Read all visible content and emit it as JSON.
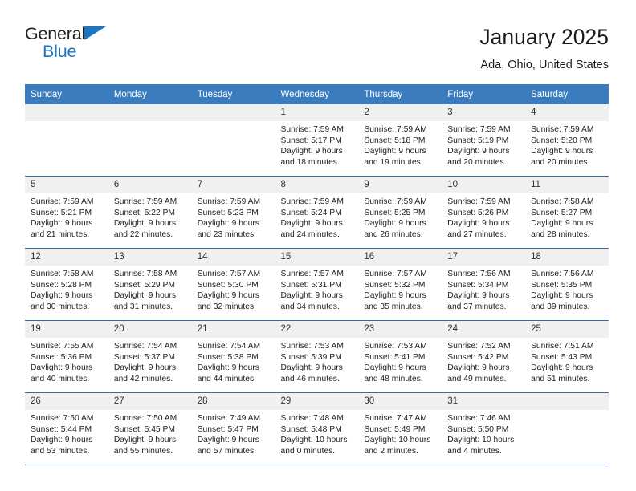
{
  "brand": {
    "name_top": "General",
    "name_bottom": "Blue",
    "triangle_color": "#1a76c4"
  },
  "header": {
    "title": "January 2025",
    "subtitle": "Ada, Ohio, United States"
  },
  "theme": {
    "header_bg": "#3a7cbe",
    "header_text": "#ffffff",
    "daynum_bg": "#f0f0f0",
    "grid_line": "#2f6ca8"
  },
  "calendar": {
    "weekday_headers": [
      "Sunday",
      "Monday",
      "Tuesday",
      "Wednesday",
      "Thursday",
      "Friday",
      "Saturday"
    ],
    "weeks": [
      [
        {
          "day": "",
          "empty": true,
          "sunrise": "",
          "sunset": "",
          "daylight_l1": "",
          "daylight_l2": ""
        },
        {
          "day": "",
          "empty": true,
          "sunrise": "",
          "sunset": "",
          "daylight_l1": "",
          "daylight_l2": ""
        },
        {
          "day": "",
          "empty": true,
          "sunrise": "",
          "sunset": "",
          "daylight_l1": "",
          "daylight_l2": ""
        },
        {
          "day": "1",
          "sunrise": "Sunrise: 7:59 AM",
          "sunset": "Sunset: 5:17 PM",
          "daylight_l1": "Daylight: 9 hours",
          "daylight_l2": "and 18 minutes."
        },
        {
          "day": "2",
          "sunrise": "Sunrise: 7:59 AM",
          "sunset": "Sunset: 5:18 PM",
          "daylight_l1": "Daylight: 9 hours",
          "daylight_l2": "and 19 minutes."
        },
        {
          "day": "3",
          "sunrise": "Sunrise: 7:59 AM",
          "sunset": "Sunset: 5:19 PM",
          "daylight_l1": "Daylight: 9 hours",
          "daylight_l2": "and 20 minutes."
        },
        {
          "day": "4",
          "sunrise": "Sunrise: 7:59 AM",
          "sunset": "Sunset: 5:20 PM",
          "daylight_l1": "Daylight: 9 hours",
          "daylight_l2": "and 20 minutes."
        }
      ],
      [
        {
          "day": "5",
          "sunrise": "Sunrise: 7:59 AM",
          "sunset": "Sunset: 5:21 PM",
          "daylight_l1": "Daylight: 9 hours",
          "daylight_l2": "and 21 minutes."
        },
        {
          "day": "6",
          "sunrise": "Sunrise: 7:59 AM",
          "sunset": "Sunset: 5:22 PM",
          "daylight_l1": "Daylight: 9 hours",
          "daylight_l2": "and 22 minutes."
        },
        {
          "day": "7",
          "sunrise": "Sunrise: 7:59 AM",
          "sunset": "Sunset: 5:23 PM",
          "daylight_l1": "Daylight: 9 hours",
          "daylight_l2": "and 23 minutes."
        },
        {
          "day": "8",
          "sunrise": "Sunrise: 7:59 AM",
          "sunset": "Sunset: 5:24 PM",
          "daylight_l1": "Daylight: 9 hours",
          "daylight_l2": "and 24 minutes."
        },
        {
          "day": "9",
          "sunrise": "Sunrise: 7:59 AM",
          "sunset": "Sunset: 5:25 PM",
          "daylight_l1": "Daylight: 9 hours",
          "daylight_l2": "and 26 minutes."
        },
        {
          "day": "10",
          "sunrise": "Sunrise: 7:59 AM",
          "sunset": "Sunset: 5:26 PM",
          "daylight_l1": "Daylight: 9 hours",
          "daylight_l2": "and 27 minutes."
        },
        {
          "day": "11",
          "sunrise": "Sunrise: 7:58 AM",
          "sunset": "Sunset: 5:27 PM",
          "daylight_l1": "Daylight: 9 hours",
          "daylight_l2": "and 28 minutes."
        }
      ],
      [
        {
          "day": "12",
          "sunrise": "Sunrise: 7:58 AM",
          "sunset": "Sunset: 5:28 PM",
          "daylight_l1": "Daylight: 9 hours",
          "daylight_l2": "and 30 minutes."
        },
        {
          "day": "13",
          "sunrise": "Sunrise: 7:58 AM",
          "sunset": "Sunset: 5:29 PM",
          "daylight_l1": "Daylight: 9 hours",
          "daylight_l2": "and 31 minutes."
        },
        {
          "day": "14",
          "sunrise": "Sunrise: 7:57 AM",
          "sunset": "Sunset: 5:30 PM",
          "daylight_l1": "Daylight: 9 hours",
          "daylight_l2": "and 32 minutes."
        },
        {
          "day": "15",
          "sunrise": "Sunrise: 7:57 AM",
          "sunset": "Sunset: 5:31 PM",
          "daylight_l1": "Daylight: 9 hours",
          "daylight_l2": "and 34 minutes."
        },
        {
          "day": "16",
          "sunrise": "Sunrise: 7:57 AM",
          "sunset": "Sunset: 5:32 PM",
          "daylight_l1": "Daylight: 9 hours",
          "daylight_l2": "and 35 minutes."
        },
        {
          "day": "17",
          "sunrise": "Sunrise: 7:56 AM",
          "sunset": "Sunset: 5:34 PM",
          "daylight_l1": "Daylight: 9 hours",
          "daylight_l2": "and 37 minutes."
        },
        {
          "day": "18",
          "sunrise": "Sunrise: 7:56 AM",
          "sunset": "Sunset: 5:35 PM",
          "daylight_l1": "Daylight: 9 hours",
          "daylight_l2": "and 39 minutes."
        }
      ],
      [
        {
          "day": "19",
          "sunrise": "Sunrise: 7:55 AM",
          "sunset": "Sunset: 5:36 PM",
          "daylight_l1": "Daylight: 9 hours",
          "daylight_l2": "and 40 minutes."
        },
        {
          "day": "20",
          "sunrise": "Sunrise: 7:54 AM",
          "sunset": "Sunset: 5:37 PM",
          "daylight_l1": "Daylight: 9 hours",
          "daylight_l2": "and 42 minutes."
        },
        {
          "day": "21",
          "sunrise": "Sunrise: 7:54 AM",
          "sunset": "Sunset: 5:38 PM",
          "daylight_l1": "Daylight: 9 hours",
          "daylight_l2": "and 44 minutes."
        },
        {
          "day": "22",
          "sunrise": "Sunrise: 7:53 AM",
          "sunset": "Sunset: 5:39 PM",
          "daylight_l1": "Daylight: 9 hours",
          "daylight_l2": "and 46 minutes."
        },
        {
          "day": "23",
          "sunrise": "Sunrise: 7:53 AM",
          "sunset": "Sunset: 5:41 PM",
          "daylight_l1": "Daylight: 9 hours",
          "daylight_l2": "and 48 minutes."
        },
        {
          "day": "24",
          "sunrise": "Sunrise: 7:52 AM",
          "sunset": "Sunset: 5:42 PM",
          "daylight_l1": "Daylight: 9 hours",
          "daylight_l2": "and 49 minutes."
        },
        {
          "day": "25",
          "sunrise": "Sunrise: 7:51 AM",
          "sunset": "Sunset: 5:43 PM",
          "daylight_l1": "Daylight: 9 hours",
          "daylight_l2": "and 51 minutes."
        }
      ],
      [
        {
          "day": "26",
          "sunrise": "Sunrise: 7:50 AM",
          "sunset": "Sunset: 5:44 PM",
          "daylight_l1": "Daylight: 9 hours",
          "daylight_l2": "and 53 minutes."
        },
        {
          "day": "27",
          "sunrise": "Sunrise: 7:50 AM",
          "sunset": "Sunset: 5:45 PM",
          "daylight_l1": "Daylight: 9 hours",
          "daylight_l2": "and 55 minutes."
        },
        {
          "day": "28",
          "sunrise": "Sunrise: 7:49 AM",
          "sunset": "Sunset: 5:47 PM",
          "daylight_l1": "Daylight: 9 hours",
          "daylight_l2": "and 57 minutes."
        },
        {
          "day": "29",
          "sunrise": "Sunrise: 7:48 AM",
          "sunset": "Sunset: 5:48 PM",
          "daylight_l1": "Daylight: 10 hours",
          "daylight_l2": "and 0 minutes."
        },
        {
          "day": "30",
          "sunrise": "Sunrise: 7:47 AM",
          "sunset": "Sunset: 5:49 PM",
          "daylight_l1": "Daylight: 10 hours",
          "daylight_l2": "and 2 minutes."
        },
        {
          "day": "31",
          "sunrise": "Sunrise: 7:46 AM",
          "sunset": "Sunset: 5:50 PM",
          "daylight_l1": "Daylight: 10 hours",
          "daylight_l2": "and 4 minutes."
        },
        {
          "day": "",
          "empty": true,
          "sunrise": "",
          "sunset": "",
          "daylight_l1": "",
          "daylight_l2": ""
        }
      ]
    ]
  }
}
